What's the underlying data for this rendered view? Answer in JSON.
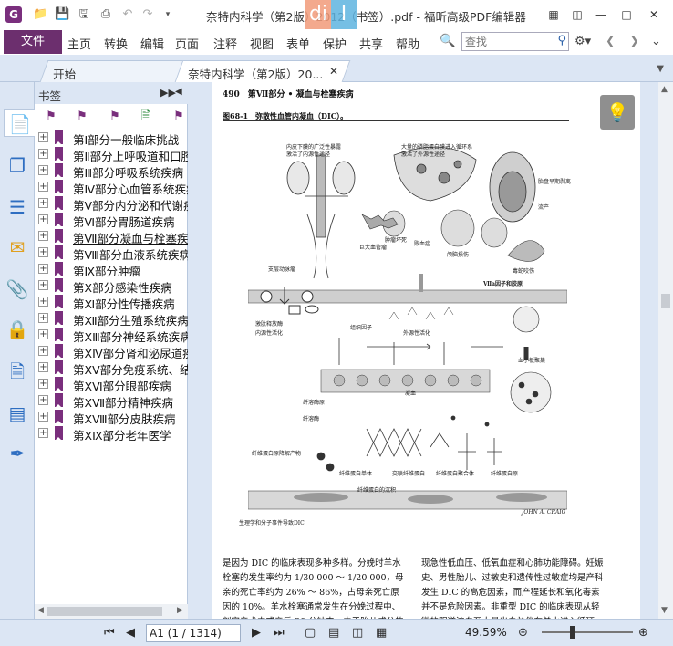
{
  "app": {
    "logo": "G",
    "title": "奈特内科学（第2版）2012（书签）.pdf - 福昕高级PDF编辑器",
    "overlay_letters": [
      "di",
      "I"
    ]
  },
  "quick_access": {
    "icons": [
      "open-folder-icon",
      "save-icon",
      "save-as-icon",
      "print-icon",
      "undo-icon",
      "redo-icon",
      "customize-dropdown-icon"
    ]
  },
  "window_controls": {
    "icons": [
      "restore-layout-icon",
      "ribbon-toggle-icon",
      "minimize-icon",
      "maximize-icon",
      "close-icon"
    ]
  },
  "menu": {
    "file_label": "文件",
    "items": [
      "主页",
      "转换",
      "编辑",
      "页面",
      "注释",
      "视图",
      "表单",
      "保护",
      "共享",
      "帮助"
    ],
    "search_placeholder": "查找"
  },
  "tabs": [
    {
      "label": "开始"
    },
    {
      "label": "奈特内科学（第2版）20..."
    }
  ],
  "bookmarks": {
    "header": "书签",
    "items": [
      "第Ⅰ部分一般临床挑战",
      "第Ⅱ部分上呼吸道和口腔",
      "第Ⅲ部分呼吸系统疾病",
      "第Ⅳ部分心血管系统疾病",
      "第Ⅴ部分内分泌和代谢疾病",
      "第Ⅵ部分胃肠道疾病",
      "第Ⅶ部分凝血与栓塞疾病",
      "第Ⅷ部分血液系统疾病",
      "第Ⅸ部分肿瘤",
      "第Ⅹ部分感染性疾病",
      "第Ⅺ部分性传播疾病",
      "第Ⅻ部分生殖系统疾病",
      "第ⅩⅢ部分神经系统疾病",
      "第ⅩⅣ部分肾和泌尿道疾病",
      "第ⅩⅤ部分免疫系统、结缔",
      "第ⅩⅥ部分眼部疾病",
      "第ⅩⅦ部分精神疾病",
      "第ⅩⅧ部分皮肤疾病",
      "第ⅩⅨ部分老年医学"
    ],
    "selected_index": 6
  },
  "document": {
    "page_header": "490　第Ⅶ部分 • 凝血与栓塞疾病",
    "figure_title": "图68-1　弥散性血管内凝血（DIC）。",
    "figure_labels": {
      "l1": "内皮下膜的广泛性暴露",
      "l1b": "激活了内源性途径",
      "l2": "大量的磷脂蛋白膜进入循环系",
      "l2b": "激活了外源性途径",
      "l3": "胎盘早期剥离",
      "l4": "流产",
      "l5": "肿瘤坏死",
      "l6": "败血症",
      "l7": "巨大血管瘤",
      "l8": "颅脑损伤",
      "l9": "支层动脉瘤",
      "l10": "毒蛇咬伤",
      "l11": "Ⅶa因子和胶原",
      "l12": "激肽释放酶",
      "l13": "内源性活化",
      "l14": "外源性活化",
      "l15": "组织因子",
      "l16": "凝血",
      "l17": "血小板聚集",
      "l18": "纤溶酶原",
      "l19": "纤溶酶",
      "l20": "纤维蛋白原降解产物",
      "l21": "纤维蛋白单体",
      "l22": "交联纤维蛋白",
      "l23": "纤维蛋白聚合体",
      "l24": "纤维蛋白原",
      "l25": "纤维蛋白的沉积",
      "l26": "生理学和分子事件导致DIC",
      "sig": "JOHN A. CRAIG"
    },
    "body_left": "是因为 DIC 的临床表现多种多样。分娩时羊水栓塞的发生率约为 1/30 000 ～ 1/20 000，母亲的死亡率约为 26% ～ 86%，占母亲死亡原因的 10%。羊水栓塞通常发生在分娩过程中、剖宫产术中或产后 30 分钟内。由于胎儿成分的大量进入，母体凝血",
    "body_right": "现急性低血压、低氧血症和心肺功能障碍。妊娠史、男性胎儿、过敏史和遗传性过敏症均是产科发生 DIC 的高危因素，而产程延长和氧化毒素并不是危险因素。非重型 DIC 的临床表现从轻微的阴道流血至大量出血并伴有羊水进入循环，也可发生在胎盘剥"
  },
  "status": {
    "page_value": "A1 (1 / 1314)",
    "zoom": "49.59%"
  }
}
